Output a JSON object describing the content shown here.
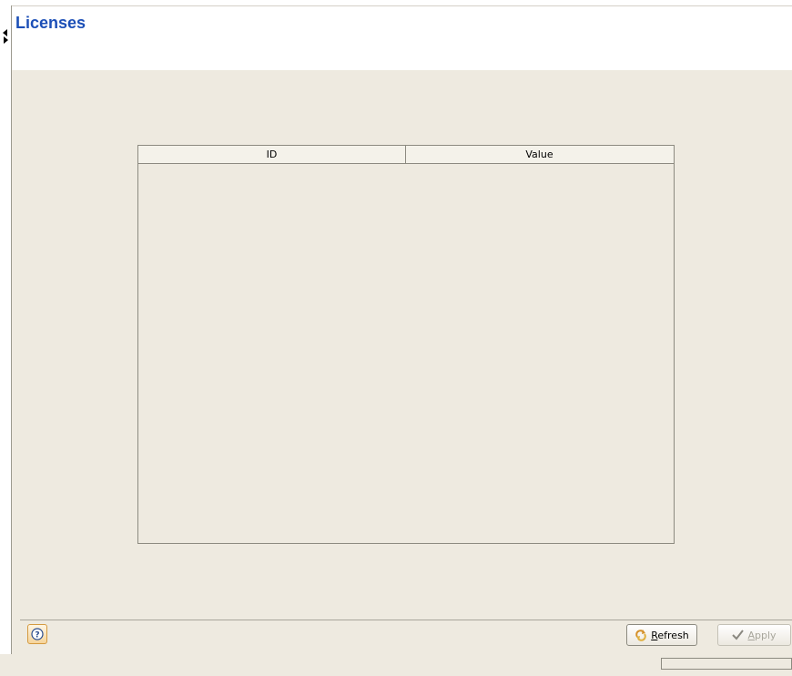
{
  "page": {
    "title": "Licenses"
  },
  "table": {
    "columns": [
      {
        "label": "ID"
      },
      {
        "label": "Value"
      }
    ],
    "rows": []
  },
  "buttons": {
    "help_icon": "help-icon",
    "refresh": {
      "prefix": "",
      "accel": "R",
      "rest": "efresh",
      "icon": "refresh-icon"
    },
    "apply": {
      "prefix": "",
      "accel": "A",
      "rest": "pply",
      "icon": "checkmark-icon",
      "enabled": false
    }
  },
  "colors": {
    "title": "#1c4fb7",
    "background": "#eeeae0",
    "header_bg": "#ffffff"
  }
}
